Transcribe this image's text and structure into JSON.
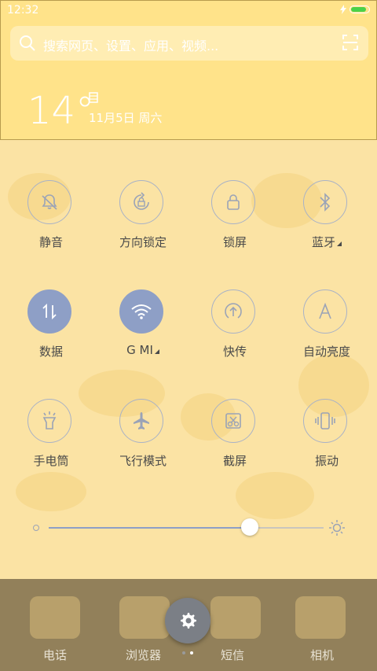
{
  "status_bar": {
    "time": "12:32",
    "battery_color": "#4ad14a"
  },
  "search": {
    "placeholder": "搜索网页、设置、应用、视频..."
  },
  "weather": {
    "temperature": "14°",
    "date": "11月5日 周六"
  },
  "toggles": [
    {
      "label": "静音",
      "icon": "bell-mute-icon",
      "active": false
    },
    {
      "label": "方向锁定",
      "icon": "rotation-lock-icon",
      "active": false
    },
    {
      "label": "锁屏",
      "icon": "lock-icon",
      "active": false
    },
    {
      "label": "蓝牙",
      "icon": "bluetooth-icon",
      "active": false
    },
    {
      "label": "数据",
      "icon": "mobile-data-icon",
      "active": true
    },
    {
      "label": "G  MI",
      "icon": "wifi-icon",
      "active": true
    },
    {
      "label": "快传",
      "icon": "share-arrow-icon",
      "active": false
    },
    {
      "label": "自动亮度",
      "icon": "auto-brightness-icon",
      "active": false
    },
    {
      "label": "手电筒",
      "icon": "flashlight-icon",
      "active": false
    },
    {
      "label": "飞行模式",
      "icon": "airplane-icon",
      "active": false
    },
    {
      "label": "截屏",
      "icon": "screenshot-icon",
      "active": false
    },
    {
      "label": "振动",
      "icon": "vibrate-icon",
      "active": false
    }
  ],
  "brightness": {
    "level": 0.73
  },
  "dock": {
    "apps": [
      "电话",
      "浏览器",
      "短信",
      "相机"
    ],
    "page_count": 2,
    "active_page": 2
  },
  "colors": {
    "accent": "#8e9fc6",
    "header": "#ffe38a",
    "background": "#fbe3a4"
  }
}
